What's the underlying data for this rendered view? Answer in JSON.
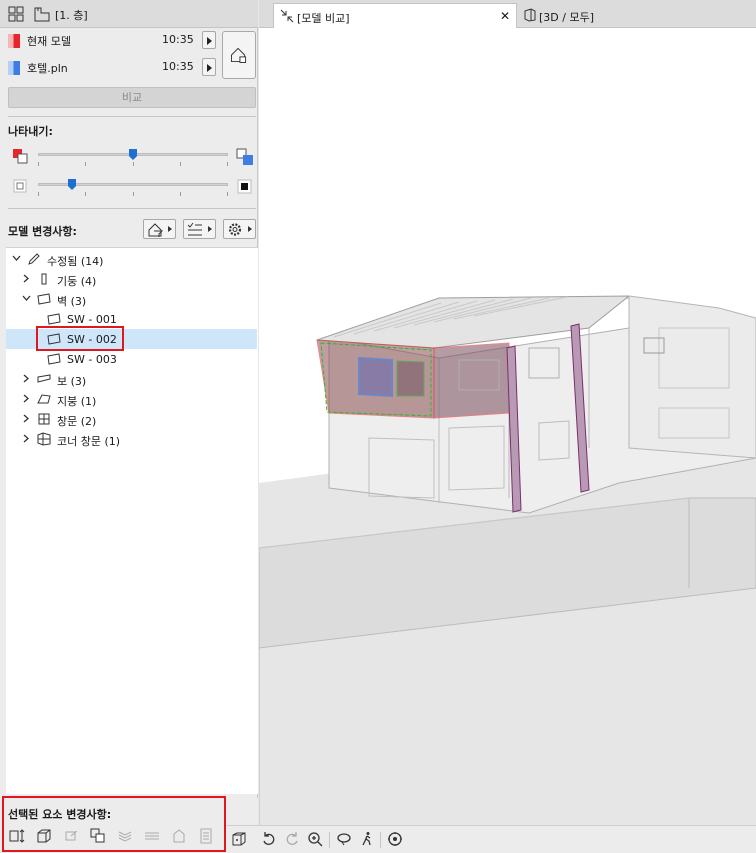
{
  "topbar": {
    "view_label": "[1. 층]"
  },
  "models": [
    {
      "name": "현재 모델",
      "time": "10:35",
      "color": "#e8252b"
    },
    {
      "name": "호텔.pln",
      "time": "10:35",
      "color": "#3d7ee6"
    }
  ],
  "compare_label": "비교",
  "display": {
    "title": "나타내기:"
  },
  "changes": {
    "title": "모델 변경사항:"
  },
  "tree": [
    {
      "label": "수정됨 (14)",
      "icon": "pencil-icon"
    },
    {
      "label": "기둥 (4)",
      "icon": "column-icon"
    },
    {
      "label": "벽 (3)",
      "icon": "wall-icon"
    },
    {
      "label": "SW - 001",
      "icon": "wall-icon"
    },
    {
      "label": "SW - 002",
      "icon": "wall-icon"
    },
    {
      "label": "SW - 003",
      "icon": "wall-icon"
    },
    {
      "label": "보 (3)",
      "icon": "beam-icon"
    },
    {
      "label": "지붕 (1)",
      "icon": "roof-icon"
    },
    {
      "label": "창문 (2)",
      "icon": "window-icon"
    },
    {
      "label": "코너 창문 (1)",
      "icon": "corner-window-icon"
    }
  ],
  "selected_changes": {
    "title": "선택된 요소 변경사항:"
  },
  "tabs": [
    {
      "label": "[모델 비교]"
    },
    {
      "label": "[3D / 모두]"
    }
  ],
  "colors": {
    "accent": "#1f6fd1",
    "highlight": "#e0181c",
    "selection": "#cfe5fa"
  }
}
